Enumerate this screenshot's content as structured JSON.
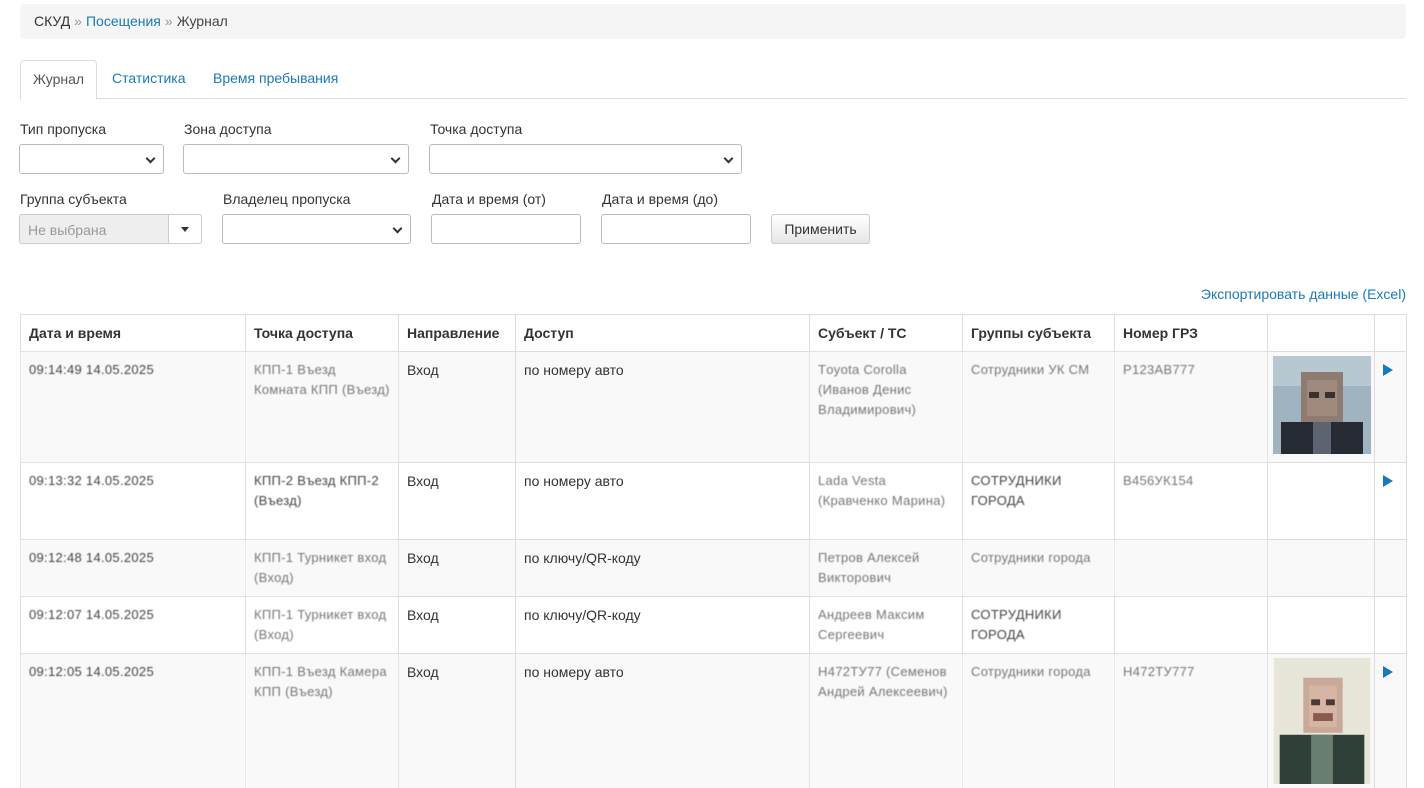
{
  "breadcrumb": {
    "root": "СКУД",
    "sep": "»",
    "link": "Посещения",
    "current": "Журнал"
  },
  "tabs": [
    {
      "label": "Журнал",
      "active": true
    },
    {
      "label": "Статистика",
      "active": false
    },
    {
      "label": "Время пребывания",
      "active": false
    }
  ],
  "filters": {
    "pass_type_label": "Тип пропуска",
    "zone_label": "Зона доступа",
    "point_label": "Точка доступа",
    "group_label": "Группа субъекта",
    "group_value": "Не выбрана",
    "owner_label": "Владелец пропуска",
    "date_from_label": "Дата и время (от)",
    "date_to_label": "Дата и время (до)",
    "apply_label": "Применить"
  },
  "export_label": "Экспортировать данные (Excel)",
  "table": {
    "headers": [
      "Дата и время",
      "Точка доступа",
      "Направление",
      "Доступ",
      "Субъект / ТС",
      "Группы субъекта",
      "Номер ГРЗ",
      "",
      ""
    ],
    "rows": [
      {
        "datetime": "09:14:49 14.05.2025",
        "point": "КПП-1 Въезд Комната КПП (Въезд)",
        "direction": "Вход",
        "access": "по номеру авто",
        "subject": "Тoyota Corolla (Иванов Денис Владимирович)",
        "groups": "Сотрудники УК СМ",
        "plate": "Р123АВ777",
        "photo": true
      },
      {
        "datetime": "09:13:32 14.05.2025",
        "point": "КПП-2 Въезд КПП-2 (Въезд)",
        "direction": "Вход",
        "access": "по номеру авто",
        "subject": "Lada Vesta (Кравченко Марина)",
        "groups": "СОТРУДНИКИ ГОРОДА",
        "plate": "В456УК154",
        "photo": false
      },
      {
        "datetime": "09:12:48 14.05.2025",
        "point": "КПП-1 Турникет вход (Вход)",
        "direction": "Вход",
        "access": "по ключу/QR-коду",
        "subject": "Петров Алексей Викторович",
        "groups": "Сотрудники города",
        "plate": "",
        "photo": false
      },
      {
        "datetime": "09:12:07 14.05.2025",
        "point": "КПП-1 Турникет вход (Вход)",
        "direction": "Вход",
        "access": "по ключу/QR-коду",
        "subject": "Андреев Максим Сергеевич",
        "groups": "СОТРУДНИКИ ГОРОДА",
        "plate": "",
        "photo": false
      },
      {
        "datetime": "09:12:05 14.05.2025",
        "point": "КПП-1 Въезд Камера КПП (Въезд)",
        "direction": "Вход",
        "access": "по номеру авто",
        "subject": "Н472ТУ77 (Семенов Андрей Алексеевич)",
        "groups": "Сотрудники города",
        "plate": "Н472ТУ777",
        "photo": true
      }
    ]
  }
}
